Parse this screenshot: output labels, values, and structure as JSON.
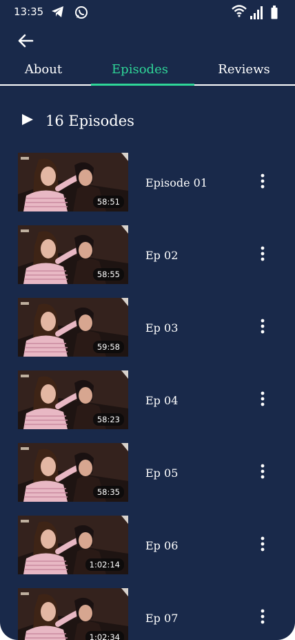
{
  "status_bar": {
    "time": "13:35",
    "left_icons": [
      "telegram-icon",
      "whatsapp-icon"
    ],
    "right_icons": [
      "wifi-icon",
      "signal-icon",
      "battery-icon"
    ]
  },
  "header": {
    "back_icon": "arrow-left-icon",
    "tabs": [
      {
        "label": "About",
        "active": false
      },
      {
        "label": "Episodes",
        "active": true
      },
      {
        "label": "Reviews",
        "active": false
      }
    ]
  },
  "episodes_section": {
    "icon": "play-icon",
    "title": "16 Episodes",
    "items": [
      {
        "title": "Episode 01",
        "duration": "58:51"
      },
      {
        "title": "Ep 02",
        "duration": "58:55"
      },
      {
        "title": "Ep 03",
        "duration": "59:58"
      },
      {
        "title": "Ep 04",
        "duration": "58:23"
      },
      {
        "title": "Ep 05",
        "duration": "58:35"
      },
      {
        "title": "Ep 06",
        "duration": "1:02:14"
      },
      {
        "title": "Ep 07",
        "duration": "1:02:34"
      }
    ]
  },
  "colors": {
    "background": "#19294a",
    "accent": "#2fd698",
    "text": "#ffffff"
  }
}
